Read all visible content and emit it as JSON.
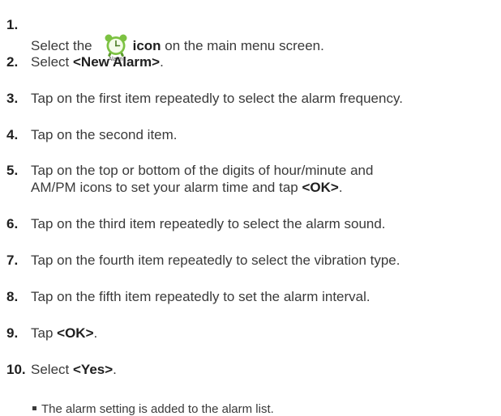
{
  "steps": [
    {
      "num": "1.",
      "pre": "Select the",
      "bold": "icon",
      "post": " on the main menu screen.",
      "icon_name": "alarm-clock-icon",
      "icon_caption": "Alarm"
    },
    {
      "num": "2.",
      "pre": "Select ",
      "bold": "<New Alarm>",
      "post": "."
    },
    {
      "num": "3.",
      "text": "Tap on the first item repeatedly to select the alarm frequency."
    },
    {
      "num": "4.",
      "text": "Tap on the second item."
    },
    {
      "num": "5.",
      "pre": "Tap on the top or bottom of the digits of hour/minute and\nAM/PM icons to set your alarm time and tap ",
      "bold": "<OK>",
      "post": "."
    },
    {
      "num": "6.",
      "text": "Tap on the third item repeatedly to select the alarm sound."
    },
    {
      "num": "7.",
      "text": "Tap on the fourth item repeatedly to select the vibration type."
    },
    {
      "num": "8.",
      "text": "Tap on the fifth item repeatedly to set the alarm interval."
    },
    {
      "num": "9.",
      "pre": "Tap ",
      "bold": "<OK>",
      "post": "."
    },
    {
      "num": "10.",
      "pre": "Select ",
      "bold": "<Yes>",
      "post": "."
    }
  ],
  "note": "The alarm setting is added to the alarm list.",
  "colors": {
    "text": "#3a3a3a",
    "icon_green": "#7cc242",
    "icon_face": "#f4fbe9"
  }
}
